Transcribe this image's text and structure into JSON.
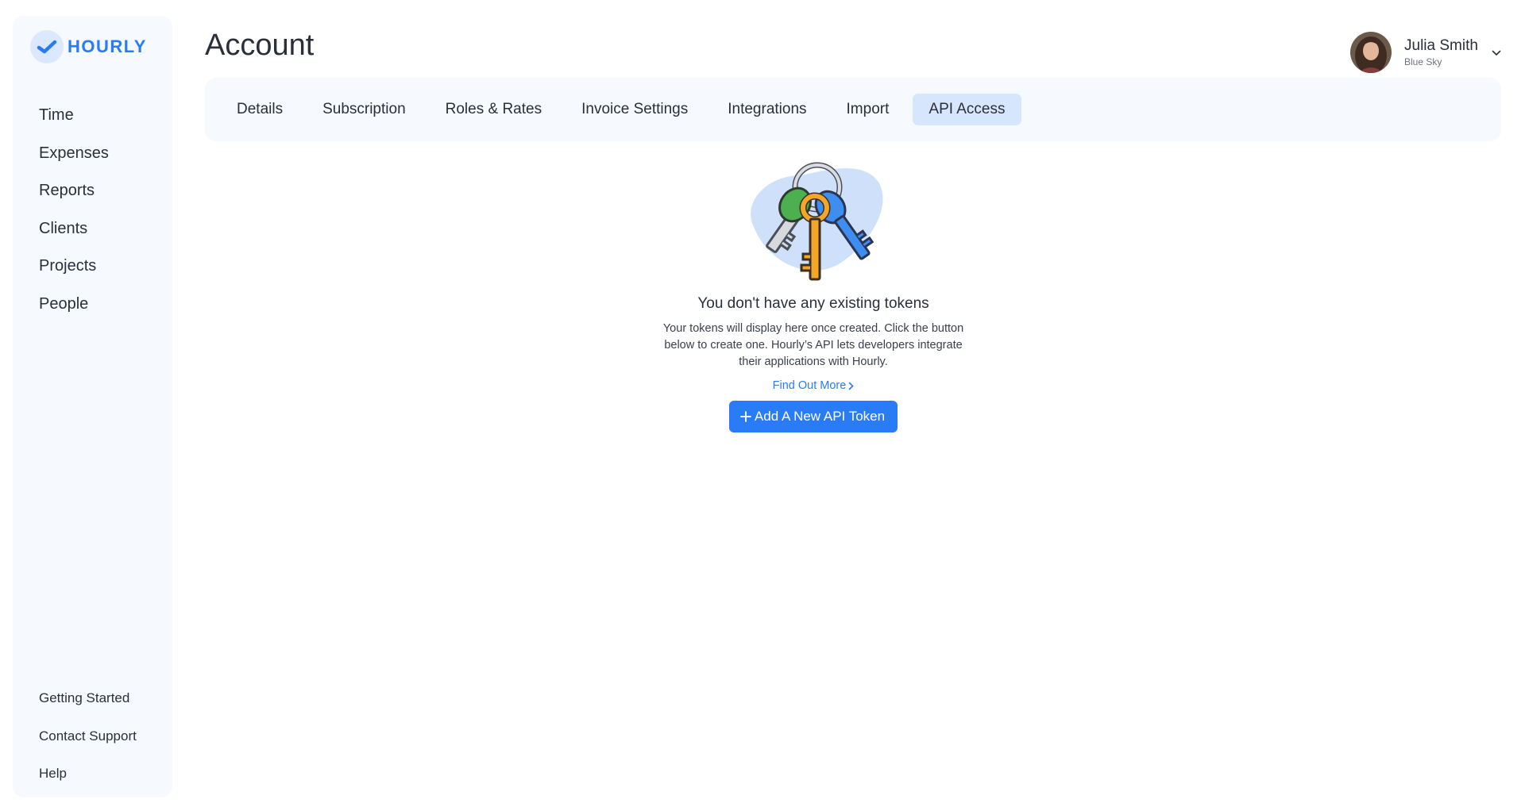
{
  "app": {
    "logo_text": "HOURLY"
  },
  "sidebar": {
    "items": [
      {
        "label": "Time"
      },
      {
        "label": "Expenses"
      },
      {
        "label": "Reports"
      },
      {
        "label": "Clients"
      },
      {
        "label": "Projects"
      },
      {
        "label": "People"
      }
    ],
    "bottom_items": [
      {
        "label": "Getting Started"
      },
      {
        "label": "Contact Support"
      },
      {
        "label": "Help"
      }
    ]
  },
  "header": {
    "title": "Account"
  },
  "user": {
    "name": "Julia Smith",
    "org": "Blue Sky"
  },
  "tabs": [
    {
      "label": "Details"
    },
    {
      "label": "Subscription"
    },
    {
      "label": "Roles & Rates"
    },
    {
      "label": "Invoice Settings"
    },
    {
      "label": "Integrations"
    },
    {
      "label": "Import"
    },
    {
      "label": "API Access",
      "active": true
    }
  ],
  "empty_state": {
    "title": "You don't have any existing tokens",
    "description": "Your tokens will display here once created. Click the button below to create one. Hourly’s API lets developers integrate their applications with Hourly.",
    "link_label": "Find Out More",
    "button_label": "Add A New API Token"
  },
  "colors": {
    "accent": "#2a7cf6",
    "sidebar_bg": "#f6f9fe",
    "active_tab_bg": "#d6e6fc"
  },
  "icons": [
    "check-logo-icon",
    "chevron-down-icon",
    "keys-illustration",
    "chevron-right-icon",
    "plus-icon"
  ]
}
